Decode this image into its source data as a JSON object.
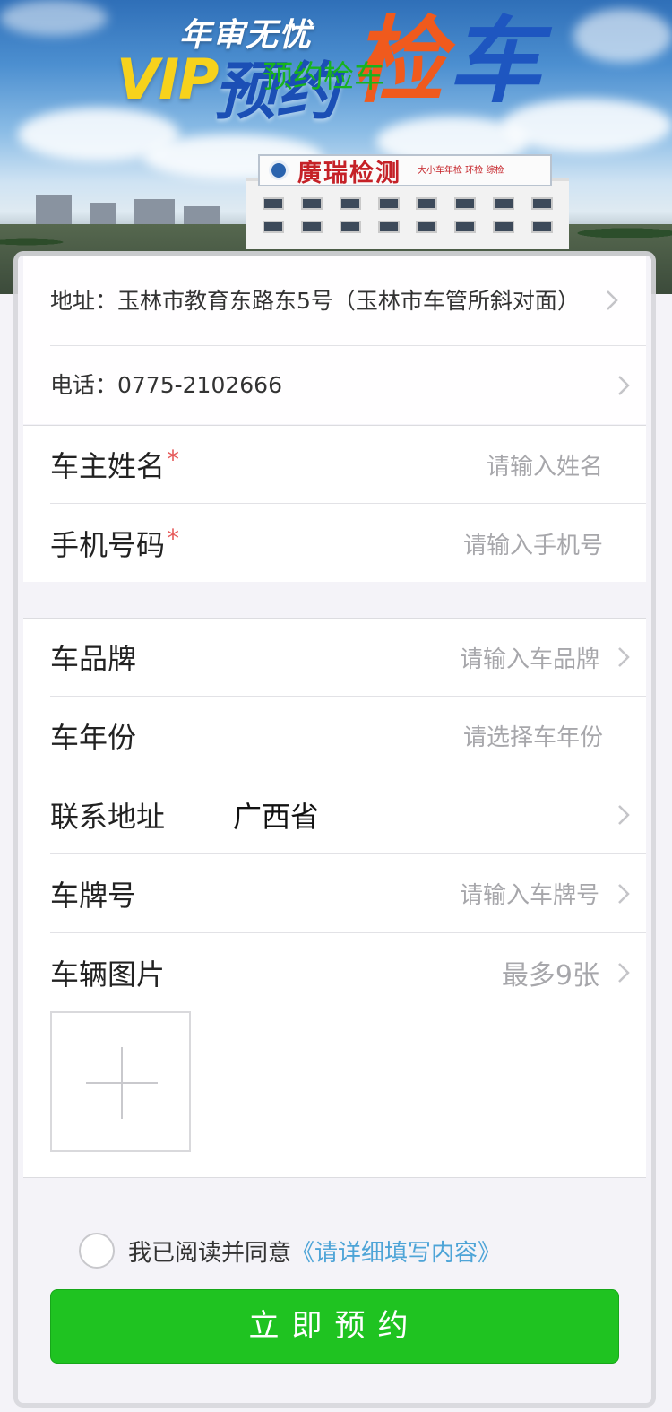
{
  "banner": {
    "line1": "年审无忧",
    "vip": "VIP",
    "yuyue": "预约",
    "jian": "检",
    "che": "车",
    "overlay_text": "预约检车",
    "sign_text": "廣瑞检测",
    "sign_side": "大小车年检 环检 综检"
  },
  "info": {
    "address": "地址：玉林市教育东路东5号（玉林市车管所斜对面）",
    "phone": "电话：0775-2102666"
  },
  "owner": {
    "name_label": "车主姓名",
    "name_placeholder": "请输入姓名",
    "phone_label": "手机号码",
    "phone_placeholder": "请输入手机号",
    "required_mark": "*"
  },
  "vehicle": {
    "brand_label": "车品牌",
    "brand_placeholder": "请输入车品牌",
    "year_label": "车年份",
    "year_placeholder": "请选择车年份",
    "address_label": "联系地址",
    "address_value": "广西省",
    "plate_label": "车牌号",
    "plate_placeholder": "请输入车牌号",
    "photo_label": "车辆图片",
    "photo_hint": "最多9张"
  },
  "agreement": {
    "text": "我已阅读并同意",
    "link": "《请详细填写内容》"
  },
  "submit_label": "立即预约",
  "colors": {
    "primary_green": "#1fc321",
    "link_blue": "#4ea4d7",
    "required_red": "#e65a5a"
  }
}
